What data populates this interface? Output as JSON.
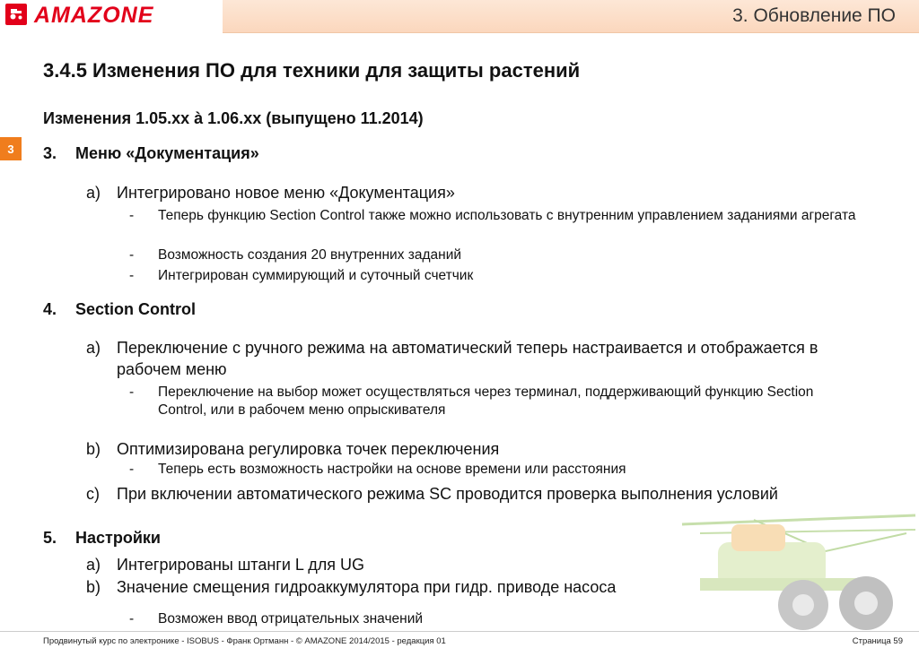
{
  "header": {
    "logo_text": "AMAZONE",
    "title": "3.  Обновление ПО"
  },
  "side_tab": "3",
  "section_title": "3.4.5 Изменения ПО для техники для защиты растений",
  "subtitle": "Изменения 1.05.xx à 1.06.xx (выпущено 11.2014)",
  "items": [
    {
      "num": "3.",
      "title": "Меню «Документация»",
      "sub": [
        {
          "letter": "a)",
          "text": "Интегрировано новое меню «Документация»",
          "bullets": [
            "Теперь функцию Section Control также можно использовать с внутренним управлением заданиями агрегата",
            "Возможность создания 20 внутренних заданий",
            "Интегрирован суммирующий и суточный счетчик"
          ]
        }
      ]
    },
    {
      "num": "4.",
      "title": "Section Control",
      "sub": [
        {
          "letter": "a)",
          "text": "Переключение с ручного режима на автоматический теперь настраивается и отображается в рабочем меню",
          "bullets": [
            "Переключение на выбор может осуществляться через терминал, поддерживающий функцию Section Control, или в рабочем меню опрыскивателя"
          ]
        },
        {
          "letter": "b)",
          "text": "Оптимизирована регулировка точек переключения",
          "bullets": [
            "Теперь есть возможность настройки на основе времени или расстояния"
          ]
        },
        {
          "letter": "c)",
          "text": "При включении автоматического режима SC проводится проверка выполнения условий",
          "bullets": []
        }
      ]
    },
    {
      "num": "5.",
      "title": "Настройки",
      "sub": [
        {
          "letter": "a)",
          "text": "Интегрированы штанги L для UG",
          "bullets": []
        },
        {
          "letter": "b)",
          "text": "Значение смещения гидроаккумулятора при гидр. приводе насоса",
          "bullets": [
            "Возможен ввод отрицательных значений"
          ]
        }
      ]
    }
  ],
  "bullet_char": "-",
  "footer": {
    "left": "Продвинутый курс по электронике - ISOBUS - Франк Ортманн - © AMAZONE 2014/2015 - редакция 01",
    "right": "Страница 59"
  },
  "colors": {
    "brand_red": "#e2001a",
    "accent_orange": "#f07d1d",
    "header_bar": "#fbd7bd"
  }
}
